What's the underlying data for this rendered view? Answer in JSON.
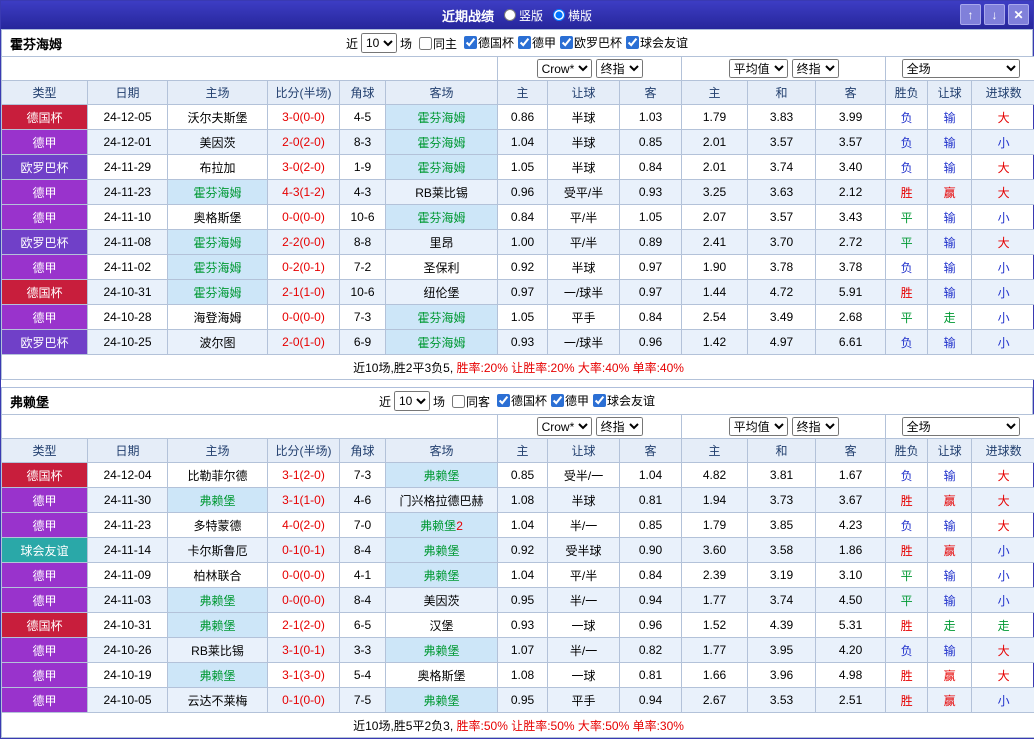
{
  "header": {
    "title": "近期战绩",
    "layout_options": [
      {
        "label": "竖版",
        "selected": false
      },
      {
        "label": "横版",
        "selected": true
      }
    ],
    "up_button": "↑",
    "down_button": "↓",
    "close_button": "✕"
  },
  "labels": {
    "near": "近",
    "games": "场"
  },
  "table_headers": {
    "left": [
      "类型",
      "日期",
      "主场",
      "比分(半场)",
      "角球",
      "客场"
    ],
    "odds_group": [
      "主",
      "让球",
      "客"
    ],
    "avg_group": [
      "主",
      "和",
      "客"
    ],
    "result_group": [
      "胜负",
      "让球",
      "进球数"
    ]
  },
  "type_colors": {
    "德国杯": "#c81e3c",
    "德甲": "#9933cc",
    "欧罗巴杯": "#7040c8",
    "球会友谊": "#2aa8a8"
  },
  "result_colors": {
    "胜": "#e60000",
    "赢": "#e60000",
    "大": "#e60000",
    "平": "#009933",
    "走": "#009933",
    "负": "#2233cc",
    "输": "#2233cc",
    "小": "#2233cc"
  },
  "sections": [
    {
      "team": "霍芬海姆",
      "filter": {
        "count": "10",
        "same": "同主",
        "leagues": [
          "德国杯",
          "德甲",
          "欧罗巴杯",
          "球会友谊"
        ]
      },
      "selects": [
        "Crow*",
        "终指",
        "平均值",
        "终指",
        "全场"
      ],
      "rows": [
        {
          "type": "德国杯",
          "date": "24-12-05",
          "home": "沃尔夫斯堡",
          "score": "3-0(0-0)",
          "corner": "4-5",
          "away": "霍芬海姆",
          "o1": "0.86",
          "line": "半球",
          "o2": "1.03",
          "a1": "1.79",
          "a2": "3.83",
          "a3": "3.99",
          "r1": "负",
          "r2": "输",
          "r3": "大"
        },
        {
          "type": "德甲",
          "date": "24-12-01",
          "home": "美因茨",
          "score": "2-0(2-0)",
          "corner": "8-3",
          "away": "霍芬海姆",
          "o1": "1.04",
          "line": "半球",
          "o2": "0.85",
          "a1": "2.01",
          "a2": "3.57",
          "a3": "3.57",
          "r1": "负",
          "r2": "输",
          "r3": "小"
        },
        {
          "type": "欧罗巴杯",
          "date": "24-11-29",
          "home": "布拉加",
          "score": "3-0(2-0)",
          "corner": "1-9",
          "away": "霍芬海姆",
          "o1": "1.05",
          "line": "半球",
          "o2": "0.84",
          "a1": "2.01",
          "a2": "3.74",
          "a3": "3.40",
          "r1": "负",
          "r2": "输",
          "r3": "大"
        },
        {
          "type": "德甲",
          "date": "24-11-23",
          "home": "霍芬海姆",
          "score": "4-3(1-2)",
          "corner": "4-3",
          "away": "RB莱比锡",
          "o1": "0.96",
          "line": "受平/半",
          "o2": "0.93",
          "a1": "3.25",
          "a2": "3.63",
          "a3": "2.12",
          "r1": "胜",
          "r2": "赢",
          "r3": "大"
        },
        {
          "type": "德甲",
          "date": "24-11-10",
          "home": "奥格斯堡",
          "score": "0-0(0-0)",
          "corner": "10-6",
          "away": "霍芬海姆",
          "o1": "0.84",
          "line": "平/半",
          "o2": "1.05",
          "a1": "2.07",
          "a2": "3.57",
          "a3": "3.43",
          "r1": "平",
          "r2": "输",
          "r3": "小"
        },
        {
          "type": "欧罗巴杯",
          "date": "24-11-08",
          "home": "霍芬海姆",
          "score": "2-2(0-0)",
          "corner": "8-8",
          "away": "里昂",
          "o1": "1.00",
          "line": "平/半",
          "o2": "0.89",
          "a1": "2.41",
          "a2": "3.70",
          "a3": "2.72",
          "r1": "平",
          "r2": "输",
          "r3": "大"
        },
        {
          "type": "德甲",
          "date": "24-11-02",
          "home": "霍芬海姆",
          "score": "0-2(0-1)",
          "corner": "7-2",
          "away": "圣保利",
          "o1": "0.92",
          "line": "半球",
          "o2": "0.97",
          "a1": "1.90",
          "a2": "3.78",
          "a3": "3.78",
          "r1": "负",
          "r2": "输",
          "r3": "小"
        },
        {
          "type": "德国杯",
          "date": "24-10-31",
          "home": "霍芬海姆",
          "score": "2-1(1-0)",
          "corner": "10-6",
          "away": "纽伦堡",
          "o1": "0.97",
          "line": "一/球半",
          "o2": "0.97",
          "a1": "1.44",
          "a2": "4.72",
          "a3": "5.91",
          "r1": "胜",
          "r2": "输",
          "r3": "小"
        },
        {
          "type": "德甲",
          "date": "24-10-28",
          "home": "海登海姆",
          "score": "0-0(0-0)",
          "corner": "7-3",
          "away": "霍芬海姆",
          "o1": "1.05",
          "line": "平手",
          "o2": "0.84",
          "a1": "2.54",
          "a2": "3.49",
          "a3": "2.68",
          "r1": "平",
          "r2": "走",
          "r3": "小"
        },
        {
          "type": "欧罗巴杯",
          "date": "24-10-25",
          "home": "波尔图",
          "score": "2-0(1-0)",
          "corner": "6-9",
          "away": "霍芬海姆",
          "o1": "0.93",
          "line": "一/球半",
          "o2": "0.96",
          "a1": "1.42",
          "a2": "4.97",
          "a3": "6.61",
          "r1": "负",
          "r2": "输",
          "r3": "小"
        }
      ],
      "summary_prefix": "近10场,胜2平3负5,",
      "summary_rates": "胜率:20% 让胜率:20% 大率:40% 单率:40%"
    },
    {
      "team": "弗赖堡",
      "filter": {
        "count": "10",
        "same": "同客",
        "leagues": [
          "德国杯",
          "德甲",
          "球会友谊"
        ]
      },
      "selects": [
        "Crow*",
        "终指",
        "平均值",
        "终指",
        "全场"
      ],
      "rows": [
        {
          "type": "德国杯",
          "date": "24-12-04",
          "home": "比勒菲尔德",
          "score": "3-1(2-0)",
          "corner": "7-3",
          "away": "弗赖堡",
          "o1": "0.85",
          "line": "受半/一",
          "o2": "1.04",
          "a1": "4.82",
          "a2": "3.81",
          "a3": "1.67",
          "r1": "负",
          "r2": "输",
          "r3": "大"
        },
        {
          "type": "德甲",
          "date": "24-11-30",
          "home": "弗赖堡",
          "score": "3-1(1-0)",
          "corner": "4-6",
          "away": "门兴格拉德巴赫",
          "o1": "1.08",
          "line": "半球",
          "o2": "0.81",
          "a1": "1.94",
          "a2": "3.73",
          "a3": "3.67",
          "r1": "胜",
          "r2": "赢",
          "r3": "大"
        },
        {
          "type": "德甲",
          "date": "24-11-23",
          "home": "多特蒙德",
          "score": "4-0(2-0)",
          "corner": "7-0",
          "away": "弗赖堡",
          "away_sup": "2",
          "o1": "1.04",
          "line": "半/一",
          "o2": "0.85",
          "a1": "1.79",
          "a2": "3.85",
          "a3": "4.23",
          "r1": "负",
          "r2": "输",
          "r3": "大"
        },
        {
          "type": "球会友谊",
          "date": "24-11-14",
          "home": "卡尔斯鲁厄",
          "score": "0-1(0-1)",
          "corner": "8-4",
          "away": "弗赖堡",
          "o1": "0.92",
          "line": "受半球",
          "o2": "0.90",
          "a1": "3.60",
          "a2": "3.58",
          "a3": "1.86",
          "r1": "胜",
          "r2": "赢",
          "r3": "小"
        },
        {
          "type": "德甲",
          "date": "24-11-09",
          "home": "柏林联合",
          "score": "0-0(0-0)",
          "corner": "4-1",
          "away": "弗赖堡",
          "o1": "1.04",
          "line": "平/半",
          "o2": "0.84",
          "a1": "2.39",
          "a2": "3.19",
          "a3": "3.10",
          "r1": "平",
          "r2": "输",
          "r3": "小"
        },
        {
          "type": "德甲",
          "date": "24-11-03",
          "home": "弗赖堡",
          "score": "0-0(0-0)",
          "corner": "8-4",
          "away": "美因茨",
          "o1": "0.95",
          "line": "半/一",
          "o2": "0.94",
          "a1": "1.77",
          "a2": "3.74",
          "a3": "4.50",
          "r1": "平",
          "r2": "输",
          "r3": "小"
        },
        {
          "type": "德国杯",
          "date": "24-10-31",
          "home": "弗赖堡",
          "score": "2-1(2-0)",
          "corner": "6-5",
          "away": "汉堡",
          "o1": "0.93",
          "line": "一球",
          "o2": "0.96",
          "a1": "1.52",
          "a2": "4.39",
          "a3": "5.31",
          "r1": "胜",
          "r2": "走",
          "r3": "走"
        },
        {
          "type": "德甲",
          "date": "24-10-26",
          "home": "RB莱比锡",
          "score": "3-1(0-1)",
          "corner": "3-3",
          "away": "弗赖堡",
          "o1": "1.07",
          "line": "半/一",
          "o2": "0.82",
          "a1": "1.77",
          "a2": "3.95",
          "a3": "4.20",
          "r1": "负",
          "r2": "输",
          "r3": "大"
        },
        {
          "type": "德甲",
          "date": "24-10-19",
          "home": "弗赖堡",
          "score": "3-1(3-0)",
          "corner": "5-4",
          "away": "奥格斯堡",
          "o1": "1.08",
          "line": "一球",
          "o2": "0.81",
          "a1": "1.66",
          "a2": "3.96",
          "a3": "4.98",
          "r1": "胜",
          "r2": "赢",
          "r3": "大"
        },
        {
          "type": "德甲",
          "date": "24-10-05",
          "home": "云达不莱梅",
          "score": "0-1(0-0)",
          "corner": "7-5",
          "away": "弗赖堡",
          "o1": "0.95",
          "line": "平手",
          "o2": "0.94",
          "a1": "2.67",
          "a2": "3.53",
          "a3": "2.51",
          "r1": "胜",
          "r2": "赢",
          "r3": "小"
        }
      ],
      "summary_prefix": "近10场,胜5平2负3,",
      "summary_rates": "胜率:50% 让胜率:50% 大率:50% 单率:30%"
    }
  ]
}
